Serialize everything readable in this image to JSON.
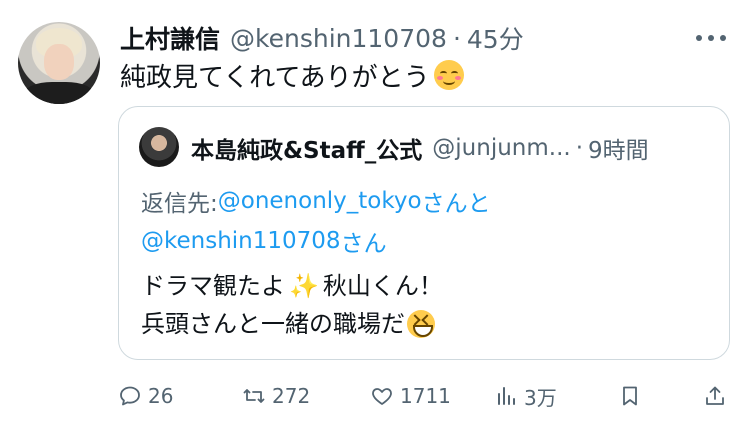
{
  "tweet": {
    "name": "上村謙信",
    "handle": "@kenshin110708",
    "separator": "·",
    "time": "45分",
    "text": "純政見てくれてありがとう"
  },
  "quoted": {
    "name": "本島純政&Staff_公式",
    "handle": "@junjunm...",
    "separator": "·",
    "time": "9時間",
    "reply_prefix": "返信先: ",
    "reply_mention_1": "@onenonly_tokyo",
    "reply_connector": " さんと",
    "reply_mention_2": "@kenshin110708",
    "reply_suffix": " さん",
    "body_line1_a": "ドラマ観たよ",
    "body_line1_b": " 秋山くん！",
    "body_line2": "兵頭さんと一緒の職場だ"
  },
  "actions": {
    "replies": "26",
    "retweets": "272",
    "likes": "1711",
    "views": "3万"
  },
  "icons": {
    "reply": "speech-bubble-icon",
    "retweet": "retweet-icon",
    "like": "heart-icon",
    "views": "bar-chart-icon",
    "bookmark": "bookmark-icon",
    "share": "share-icon",
    "more": "more-dots-icon"
  },
  "colors": {
    "text": "#0f1419",
    "secondary": "#536471",
    "link": "#1d9bf0",
    "border": "#cfd9de"
  }
}
